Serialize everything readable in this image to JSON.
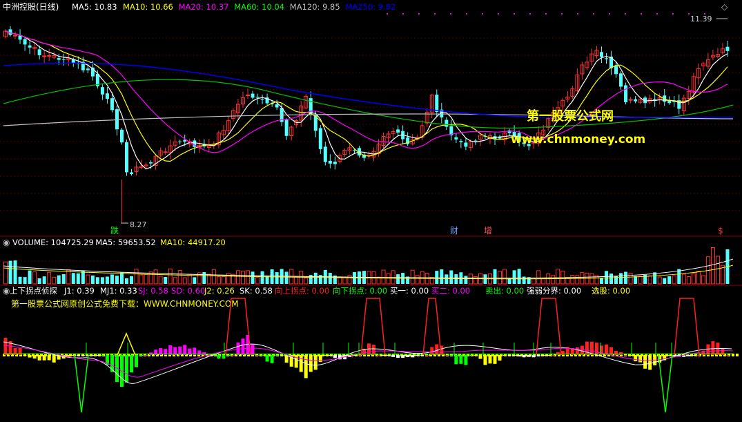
{
  "stock_title": "中洲控股(日线)",
  "ma_legend": [
    {
      "label": "MA5: 10.83",
      "color": "#ffffff"
    },
    {
      "label": "MA10: 10.66",
      "color": "#ffff00"
    },
    {
      "label": "MA20: 10.37",
      "color": "#ff00ff"
    },
    {
      "label": "MA60: 10.04",
      "color": "#00ff00"
    },
    {
      "label": "MA120: 9.85",
      "color": "#c0c0c0"
    },
    {
      "label": "MA250: 9.82",
      "color": "#0000ff"
    }
  ],
  "price_high_label": "11.39",
  "price_low_label": "8.27",
  "event_markers": [
    {
      "label": "跌",
      "color": "#00ff00"
    },
    {
      "label": "财",
      "color": "#6aa0ff"
    },
    {
      "label": "增",
      "color": "#ff5050"
    },
    {
      "label": "$",
      "color": "#ff3030"
    }
  ],
  "watermark_line1": "第一股票公式网",
  "watermark_line2": "www.chnmoney.com",
  "volume_legend": [
    {
      "label": "VOLUME: 104725.29",
      "color": "#ffffff"
    },
    {
      "label": "MA5: 59653.52",
      "color": "#ffffff"
    },
    {
      "label": "MA10: 44917.20",
      "color": "#ffff00"
    }
  ],
  "indicator_legend": [
    {
      "label": "上下拐点侦探",
      "color": "#ffffff"
    },
    {
      "label": "J1: 0.39",
      "color": "#ffffff"
    },
    {
      "label": "MJ1: 0.33",
      "color": "#ffffff"
    },
    {
      "label": "SJ: 0.58",
      "color": "#ff00ff"
    },
    {
      "label": "SD: 0.60",
      "color": "#ff00ff"
    },
    {
      "label": "J2: 0.26",
      "color": "#ffff00"
    },
    {
      "label": "SK: 0.58",
      "color": "#ffffff"
    },
    {
      "label": "向上拐点: 0.00",
      "color": "#ff2020"
    },
    {
      "label": "向下拐点: 0.00",
      "color": "#00ff00"
    },
    {
      "label": "买一: 0.00",
      "color": "#ffffff"
    },
    {
      "label": "买二: 0.00",
      "color": "#ff00ff"
    },
    {
      "label": "卖出: 0.00",
      "color": "#00ff00"
    },
    {
      "label": "强弱分界: 0.00",
      "color": "#ffffff"
    },
    {
      "label": "选股: 0.00",
      "color": "#ffff00"
    }
  ],
  "indicator_note": "第一股票公式网原创公式免费下载：WWW.CHNMONEY.COM",
  "colors": {
    "up": "#ff3232",
    "down": "#54ffff",
    "grid": "#7a0000",
    "ma250": "#0000ff",
    "ma120": "#c0c0c0",
    "ma60": "#00c000"
  }
}
